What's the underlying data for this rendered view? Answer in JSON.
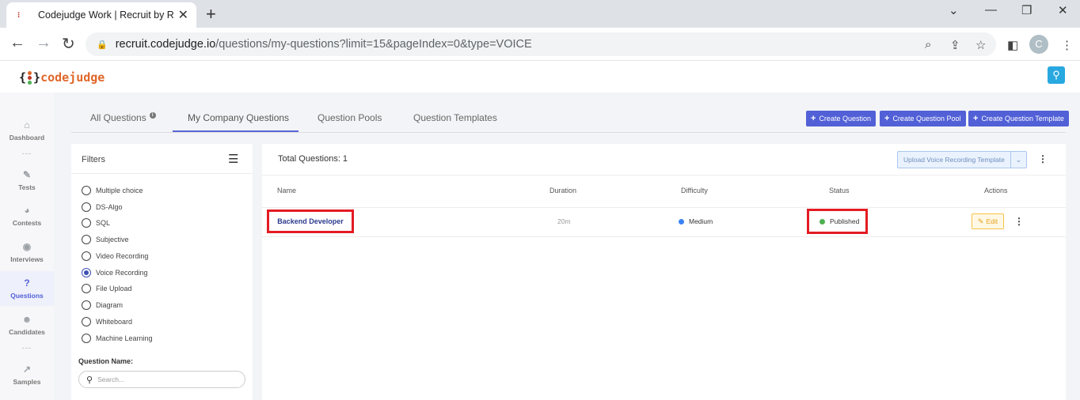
{
  "browser": {
    "tab_title": "Codejudge Work | Recruit by Rea",
    "new_tab": "+",
    "url_host": "recruit.codejudge.io",
    "url_path": "/questions/my-questions?limit=15&pageIndex=0&type=VOICE",
    "profile_initial": "C"
  },
  "app": {
    "logo_open": "{",
    "logo_text": "codejudge",
    "logo_close": "}",
    "user_icon": "person-icon"
  },
  "sidebar": {
    "items": [
      {
        "label": "Dashboard",
        "icon": "home-icon",
        "glyph": "⌂"
      },
      {
        "label": "Tests",
        "icon": "pencil-icon",
        "glyph": "✎"
      },
      {
        "label": "Contests",
        "icon": "pie-chart-icon",
        "glyph": "◕"
      },
      {
        "label": "Interviews",
        "icon": "podcast-icon",
        "glyph": "◉"
      },
      {
        "label": "Questions",
        "icon": "question-circle-icon",
        "glyph": "?"
      },
      {
        "label": "Candidates",
        "icon": "users-icon",
        "glyph": "☻"
      },
      {
        "label": "Samples",
        "icon": "line-chart-icon",
        "glyph": "↗"
      }
    ],
    "active": "Questions",
    "separator": "---"
  },
  "tabs": {
    "all": "All Questions",
    "company": "My Company Questions",
    "pools": "Question Pools",
    "templates": "Question Templates",
    "info_glyph": "i"
  },
  "actions": {
    "plus": "+",
    "create_question": "Create Question",
    "create_pool": "Create Question Pool",
    "create_template": "Create Question Template"
  },
  "filters": {
    "title": "Filters",
    "options": [
      "Multiple choice",
      "DS-Algo",
      "SQL",
      "Subjective",
      "Video Recording",
      "Voice Recording",
      "File Upload",
      "Diagram",
      "Whiteboard",
      "Machine Learning"
    ],
    "selected": "Voice Recording",
    "question_name_label": "Question Name:",
    "search_placeholder": "Search..."
  },
  "table": {
    "total": "Total Questions: 1",
    "upload_button": "Upload Voice Recording Template",
    "headers": {
      "name": "Name",
      "duration": "Duration",
      "difficulty": "Difficulty",
      "status": "Status",
      "actions": "Actions"
    },
    "rows": [
      {
        "name": "Backend Developer",
        "duration": "20m",
        "difficulty": "Medium",
        "status": "Published",
        "edit": "Edit"
      }
    ]
  },
  "colors": {
    "accent": "#5160d6",
    "highlight": "#e31b23",
    "difficulty_medium": "#3b82f6",
    "status_published": "#4caf50",
    "edit": "#e4a11b"
  }
}
